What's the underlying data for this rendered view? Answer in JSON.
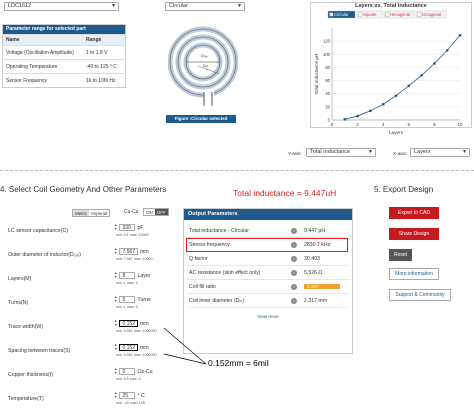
{
  "top": {
    "part_select": "LDC1612",
    "param_table": {
      "title": "Parameter range for selected part",
      "headers": [
        "Name",
        "Range"
      ],
      "rows": [
        [
          "Voltage (Oscillation Amplitude)",
          "1 to 1.8 V"
        ],
        [
          "Operating Temperature",
          "-40 to 125 ° C"
        ],
        [
          "Sensor Frequency",
          "1k to 10M Hz"
        ]
      ]
    },
    "shape_select": "Circular",
    "figure_caption": "Figure :Circular selected",
    "coil_labels": {
      "dout": "Dₒᵤₜ",
      "din": "Dᵢₙ"
    }
  },
  "chart_title": "Layers vs. Total Inductance",
  "chart_data": {
    "type": "line",
    "legend": [
      "Circular",
      "Square",
      "Hexagonal",
      "Octagonal"
    ],
    "legend_checked": [
      true,
      false,
      false,
      false
    ],
    "x": [
      1,
      2,
      3,
      4,
      5,
      6,
      7,
      8,
      9,
      10
    ],
    "series": [
      {
        "name": "Circular",
        "values": [
          1,
          6,
          14,
          24,
          37,
          52,
          68,
          86,
          106,
          129
        ]
      }
    ],
    "xticks": [
      "0",
      "2",
      "4",
      "6",
      "8",
      "10"
    ],
    "yticks": [
      "0",
      "20",
      "40",
      "60",
      "80",
      "100",
      "120"
    ],
    "xlim": [
      0,
      10
    ],
    "ylim": [
      0,
      140
    ],
    "xlabel": "Layers",
    "ylabel": "Total Inductance µH"
  },
  "axis_selectors": {
    "y_label": "Y-axis:",
    "y_value": "Total Inductance",
    "x_label": "X-axis:",
    "x_value": "Layers"
  },
  "section4": {
    "title": "4. Select Coil Geometry And Other Parameters",
    "metric": "Metric",
    "imperial": "Imperial",
    "cu_label": "Cu-Cu",
    "on": "ON",
    "off": "OFF",
    "params": [
      {
        "label": "LC sensor capacitance(C)",
        "value": "330",
        "unit": "pF",
        "range": "min: 0.1  max: 10000"
      },
      {
        "label": "Outer diameter of inductor(Dₒᵤₜ)",
        "value": "7.567",
        "unit": "mm",
        "range": "min: 7.067  max: 10000"
      },
      {
        "label": "Layers(M)",
        "value": "8",
        "unit": "Layer",
        "range": "min: 1  max: 4"
      },
      {
        "label": "Turns(N)",
        "value": "5",
        "unit": "Turns",
        "range": "min: 1  max: 5"
      },
      {
        "label": "Trace width(W)",
        "value": "0.152",
        "unit": "mm",
        "range": "min: 0.051  max: 1000000"
      },
      {
        "label": "Spacing between traces(S)",
        "value": "0.152",
        "unit": "mm",
        "range": "min: 0.051  max: 1000000"
      },
      {
        "label": "Copper thickness(t)",
        "value": "0",
        "unit": "Oz-Cu",
        "range": "min: 0.5  max: 2"
      },
      {
        "label": "Temperature(T)",
        "value": "25",
        "unit": "° C",
        "range": "min: -40  max: 125"
      }
    ]
  },
  "output": {
    "title": "Output Parameters",
    "rows": [
      {
        "label": "Total inductance - Circular",
        "value": "9.447 µH"
      },
      {
        "label": "Sensor frequency",
        "value": "2830.7 kHz"
      },
      {
        "label": "Q factor",
        "value": "30.403"
      },
      {
        "label": "AC resistance (skin effect only)",
        "value": "5.526 Ω"
      },
      {
        "label": "Coil fill ratio",
        "value": "0.157"
      },
      {
        "label": "Coil inner diameter (Dᵢₙ)",
        "value": "2.317 mm"
      }
    ],
    "view_more": "View more"
  },
  "annotations": {
    "inductance": "Total inductance = 9.447uH",
    "trace": "0.152mm = 6mil"
  },
  "export": {
    "title": "5. Export Design",
    "buttons": [
      "Export to CAD",
      "Share Design",
      "Reset",
      "More information",
      "Support & Community"
    ]
  },
  "colors": {
    "brand_blue": "#1f5a8c",
    "red": "#c8191e",
    "fill_ratio": "#f0a030"
  }
}
